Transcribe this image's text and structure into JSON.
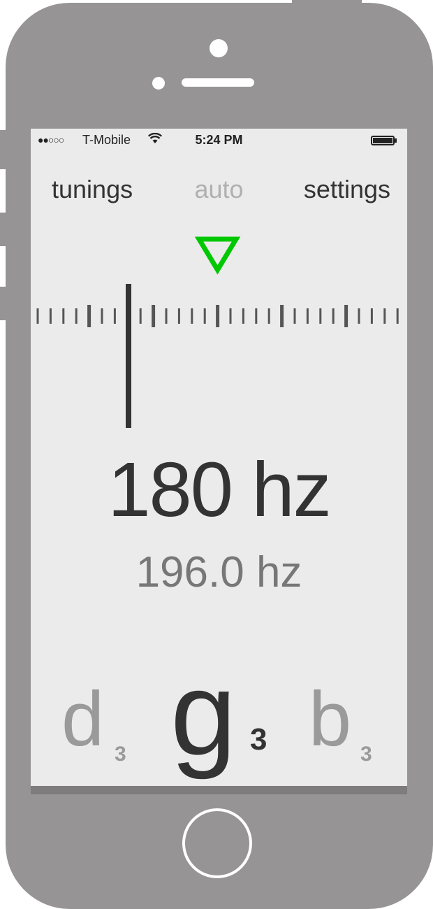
{
  "status_bar": {
    "signal": "●●○○○",
    "carrier": "T-Mobile",
    "time": "5:24 PM"
  },
  "nav": {
    "tunings": "tunings",
    "auto": "auto",
    "settings": "settings"
  },
  "tuner": {
    "detected_frequency": "180 hz",
    "target_frequency": "196.0 hz",
    "indicator_color": "#00c800",
    "needle_color": "#333333"
  },
  "notes": {
    "previous": {
      "name": "d",
      "octave": "3"
    },
    "current": {
      "name": "g",
      "octave": "3"
    },
    "next": {
      "name": "b",
      "octave": "3"
    }
  },
  "colors": {
    "frame": "#969495",
    "screen": "#ebebeb",
    "text_primary": "#333333",
    "text_muted": "#9a9a9a"
  }
}
